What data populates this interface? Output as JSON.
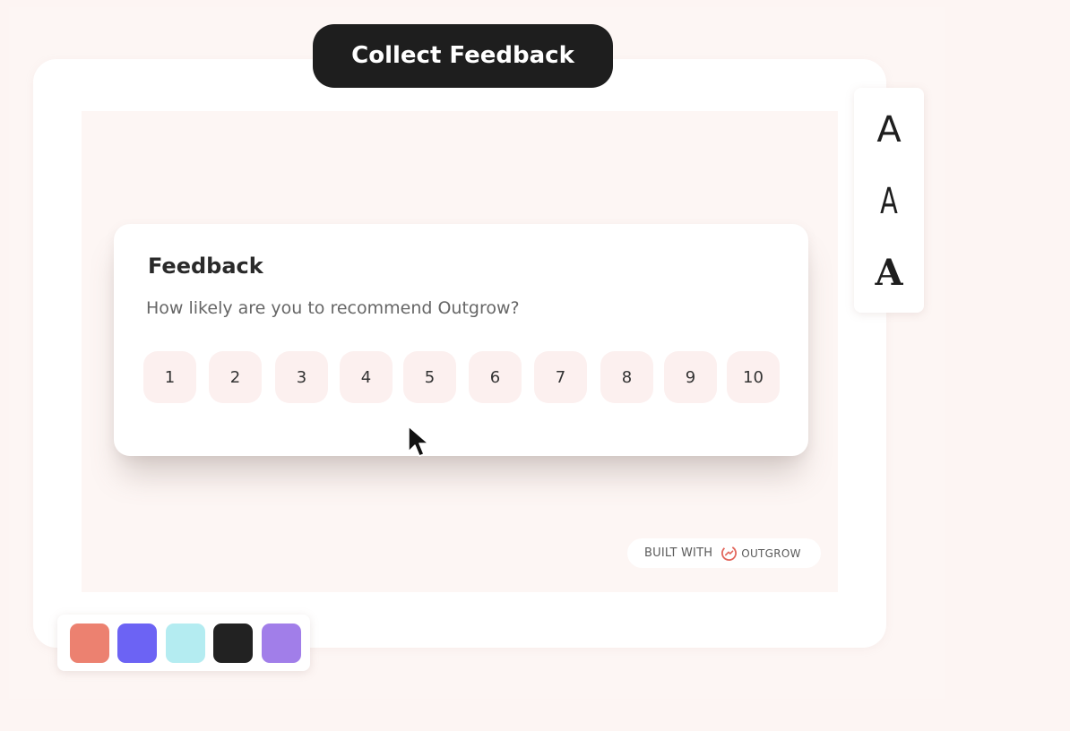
{
  "header": {
    "title": "Collect Feedback"
  },
  "card": {
    "title": "Feedback",
    "question": "How likely are you to recommend Outgrow?",
    "scale": [
      "1",
      "2",
      "3",
      "4",
      "5",
      "6",
      "7",
      "8",
      "9",
      "10"
    ]
  },
  "font_panel": {
    "options": [
      "A",
      "A",
      "A"
    ]
  },
  "footer": {
    "built_with": "BUILT WITH",
    "brand": "OUTGROW",
    "logo_icon": "outgrow-logo-icon"
  },
  "palette": {
    "swatches": [
      "#ec8170",
      "#6c63f4",
      "#b4ecf1",
      "#222222",
      "#a17ee9"
    ]
  },
  "colors": {
    "background": "#fdf5f3",
    "title_pill": "#1e1e1e",
    "scale_button": "#fcf0ef",
    "logo_accent": "#e2665c"
  }
}
